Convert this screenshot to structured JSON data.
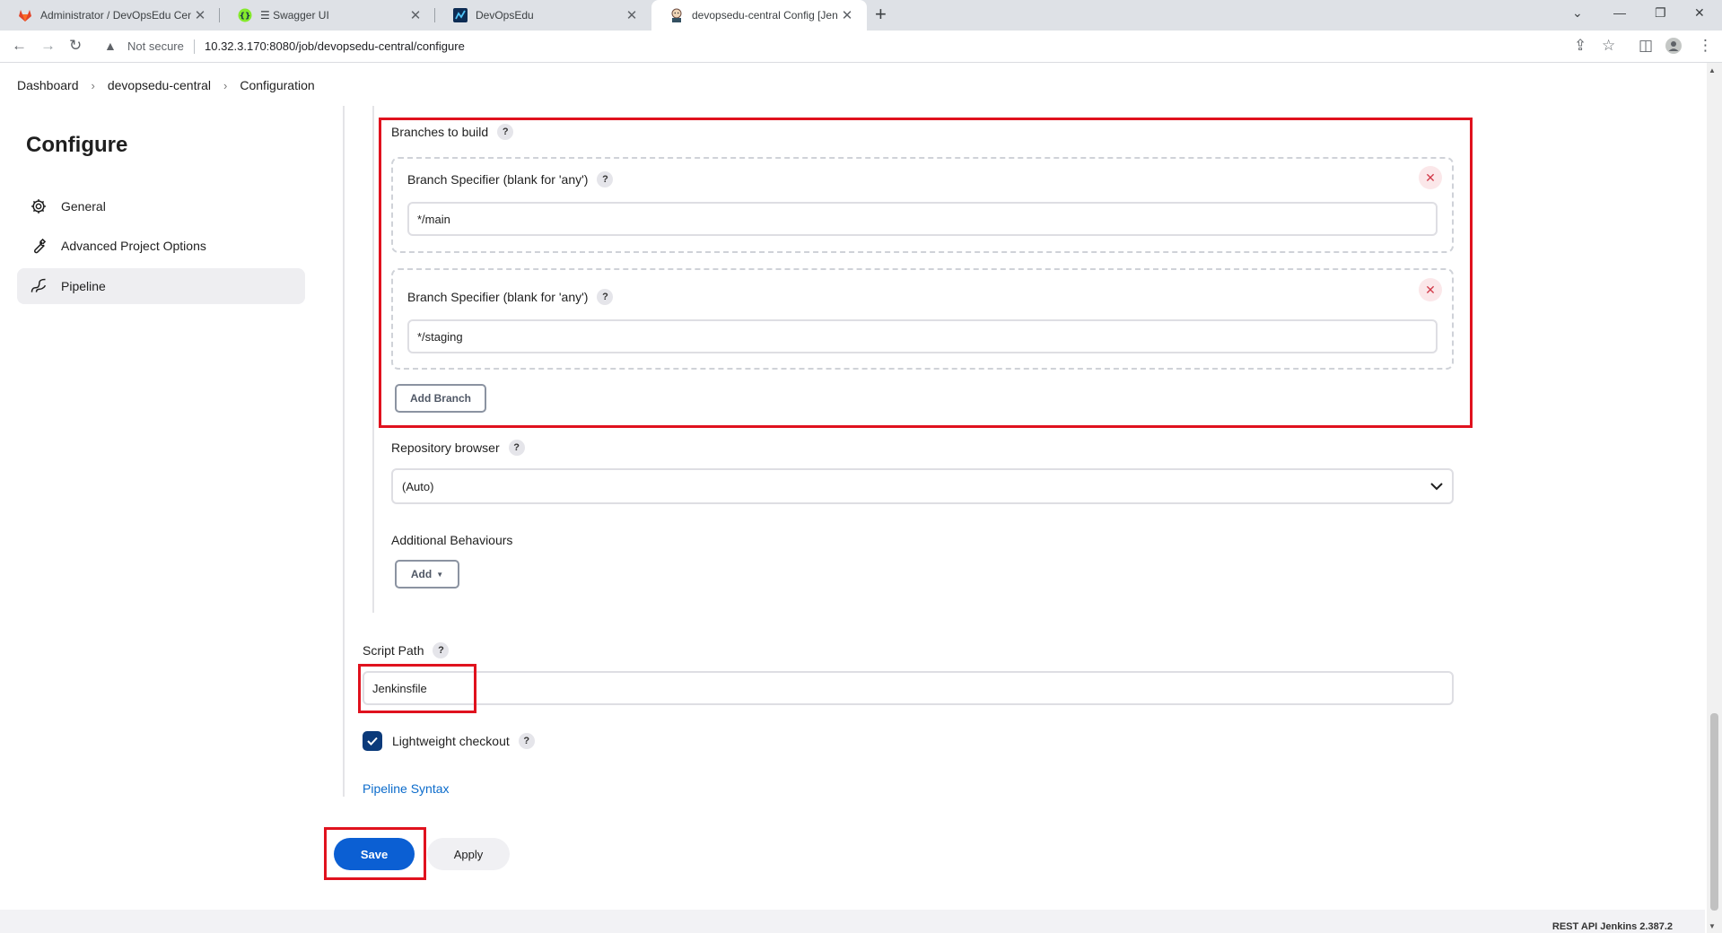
{
  "browser": {
    "tabs": [
      {
        "title": "Administrator / DevOpsEdu Central",
        "icon": "gitlab-icon"
      },
      {
        "title": "☰ Swagger UI",
        "icon": "swagger-icon"
      },
      {
        "title": "DevOpsEdu",
        "icon": "app-icon"
      },
      {
        "title": "devopsedu-central Config [Jenkins]",
        "icon": "jenkins-icon"
      }
    ],
    "not_secure": "Not secure",
    "url": "10.32.3.170:8080/job/devopsedu-central/configure"
  },
  "breadcrumb": [
    "Dashboard",
    "devopsedu-central",
    "Configuration"
  ],
  "sidebar": {
    "title": "Configure",
    "items": [
      {
        "label": "General",
        "icon": "gear-icon"
      },
      {
        "label": "Advanced Project Options",
        "icon": "wrench-icon"
      },
      {
        "label": "Pipeline",
        "icon": "pipeline-icon"
      }
    ]
  },
  "form": {
    "branches_label": "Branches to build",
    "help": "?",
    "branch_specifier_label": "Branch Specifier (blank for 'any')",
    "branches": [
      "*/main",
      "*/staging"
    ],
    "add_branch": "Add Branch",
    "repo_browser_label": "Repository browser",
    "repo_browser_value": "(Auto)",
    "additional_behaviours_label": "Additional Behaviours",
    "add_button": "Add",
    "script_path_label": "Script Path",
    "script_path_value": "Jenkinsfile",
    "lightweight_checkout_label": "Lightweight checkout",
    "pipeline_syntax_link": "Pipeline Syntax",
    "save": "Save",
    "apply": "Apply"
  },
  "footer": {
    "text": "REST API     Jenkins 2.387.2"
  },
  "colors": {
    "highlight": "#e0121e",
    "primary": "#0b5fd3",
    "link": "#0b6bcb"
  }
}
